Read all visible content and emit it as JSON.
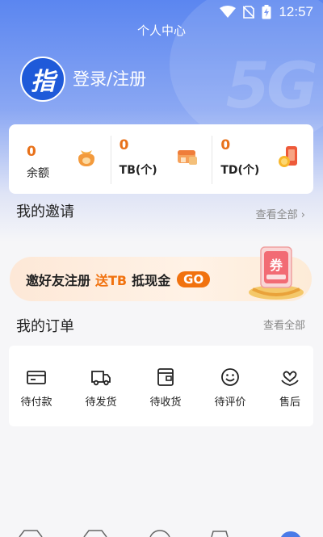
{
  "status_bar": {
    "time": "12:57"
  },
  "header": {
    "title": "个人中心",
    "login_label": "登录/注册",
    "avatar_text": "指"
  },
  "balances": [
    {
      "value": "0",
      "label": "余额"
    },
    {
      "value": "0",
      "label": "TB(个)"
    },
    {
      "value": "0",
      "label": "TD(个)"
    }
  ],
  "invite": {
    "title": "我的邀请",
    "view_all": "查看全部",
    "banner_text_1": "邀好友注册",
    "banner_highlight": "送TB",
    "banner_text_2": "抵现金",
    "banner_go": "GO",
    "coupon_text": "券"
  },
  "orders": {
    "title": "我的订单",
    "view_all": "查看全部",
    "items": [
      {
        "label": "待付款",
        "icon": "wallet-icon"
      },
      {
        "label": "待发货",
        "icon": "truck-icon"
      },
      {
        "label": "待收货",
        "icon": "package-icon"
      },
      {
        "label": "待评价",
        "icon": "smile-icon"
      },
      {
        "label": "售后",
        "icon": "heart-hand-icon"
      }
    ]
  },
  "colors": {
    "accent": "#f1720f",
    "header_blue": "#5b86f0"
  }
}
